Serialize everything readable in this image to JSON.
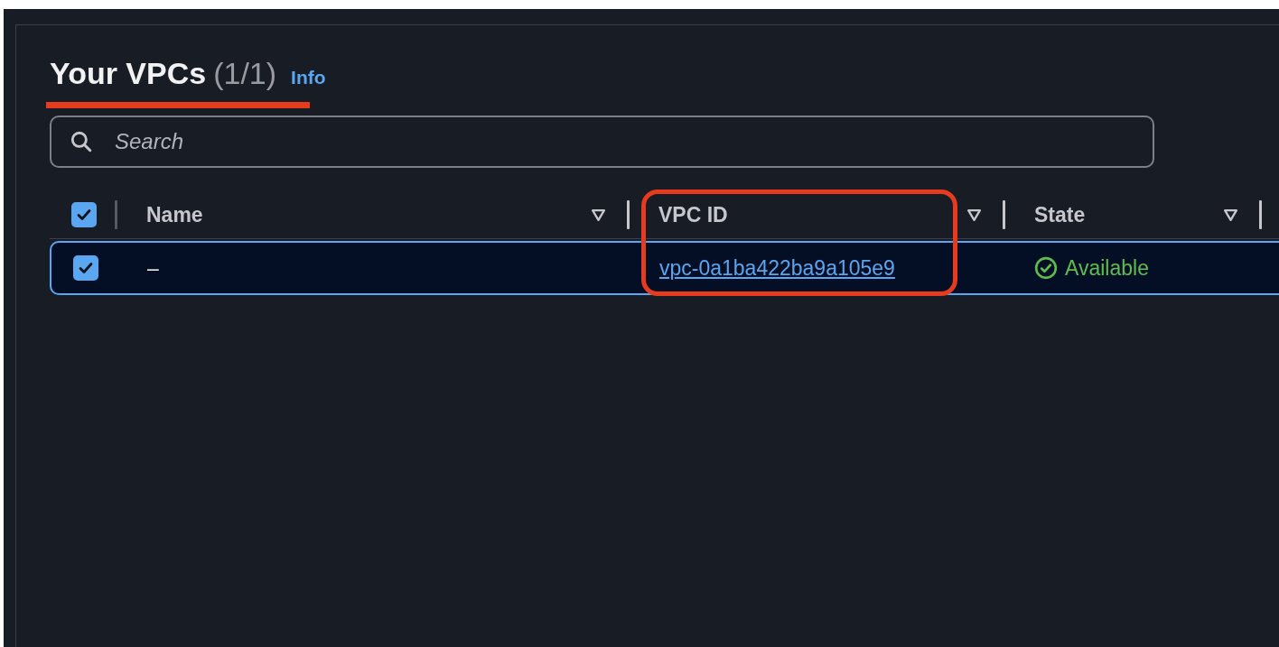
{
  "header": {
    "title": "Your VPCs",
    "count": "(1/1)",
    "info": "Info"
  },
  "search": {
    "placeholder": "Search"
  },
  "table": {
    "select_all_checked": true,
    "columns": [
      {
        "label": "Name"
      },
      {
        "label": "VPC ID"
      },
      {
        "label": "State"
      }
    ],
    "rows": [
      {
        "selected": true,
        "name": "–",
        "vpc_id": "vpc-0a1ba422ba9a105e9",
        "state": "Available",
        "kind": "success"
      }
    ]
  }
}
